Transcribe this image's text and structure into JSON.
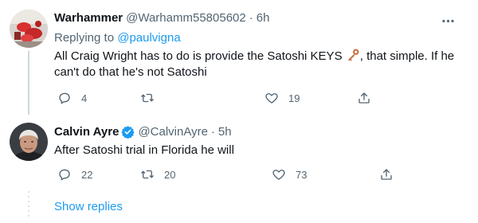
{
  "tweets": [
    {
      "name": "Warhammer",
      "handle": "@Warhamm55805602",
      "separator": "·",
      "time": "6h",
      "replying_prefix": "Replying to ",
      "replying_handle": "@paulvigna",
      "text_before_emoji": "All Craig Wright has to do is provide the Satoshi KEYS ",
      "text_after_emoji_line1": ", that simple. If he",
      "text_line2": "can't do that he's not Satoshi",
      "emoji": "key-icon",
      "reply_count": "4",
      "retweet_count": "",
      "like_count": "19"
    },
    {
      "name": "Calvin Ayre",
      "handle": "@CalvinAyre",
      "separator": "·",
      "time": "5h",
      "verified": true,
      "text": "After Satoshi trial in Florida he will",
      "reply_count": "22",
      "retweet_count": "20",
      "like_count": "73"
    }
  ],
  "show_replies": "Show replies",
  "colors": {
    "accent": "#1d9bf0",
    "secondary_text": "#536471",
    "thread_line": "#cfd9de"
  }
}
